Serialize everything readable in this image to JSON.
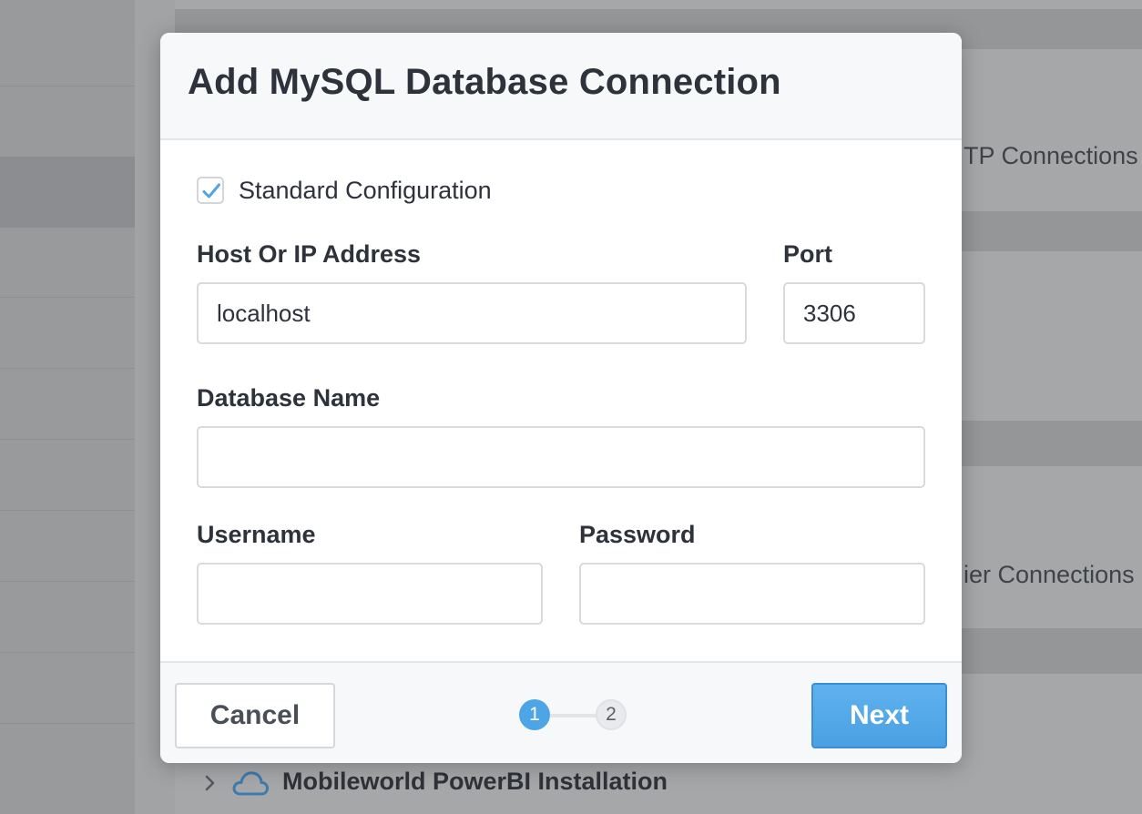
{
  "background": {
    "row_text_1": "TP Connections",
    "row_text_2": "ier Connections",
    "installation_label": "Mobileworld PowerBI Installation",
    "installation_icon": "cloud-icon"
  },
  "modal": {
    "title": "Add MySQL Database Connection",
    "standard_config": {
      "label": "Standard Configuration",
      "checked": true
    },
    "host": {
      "label": "Host Or IP Address",
      "value": "localhost",
      "placeholder": ""
    },
    "port": {
      "label": "Port",
      "value": "3306"
    },
    "database": {
      "label": "Database Name",
      "value": ""
    },
    "username": {
      "label": "Username",
      "value": ""
    },
    "password": {
      "label": "Password",
      "value": ""
    },
    "footer": {
      "cancel_label": "Cancel",
      "next_label": "Next",
      "steps": [
        "1",
        "2"
      ],
      "current_step": 1
    }
  },
  "colors": {
    "accent": "#4ea5e6",
    "text": "#2e323a",
    "overlay": "#9a9b9d"
  }
}
